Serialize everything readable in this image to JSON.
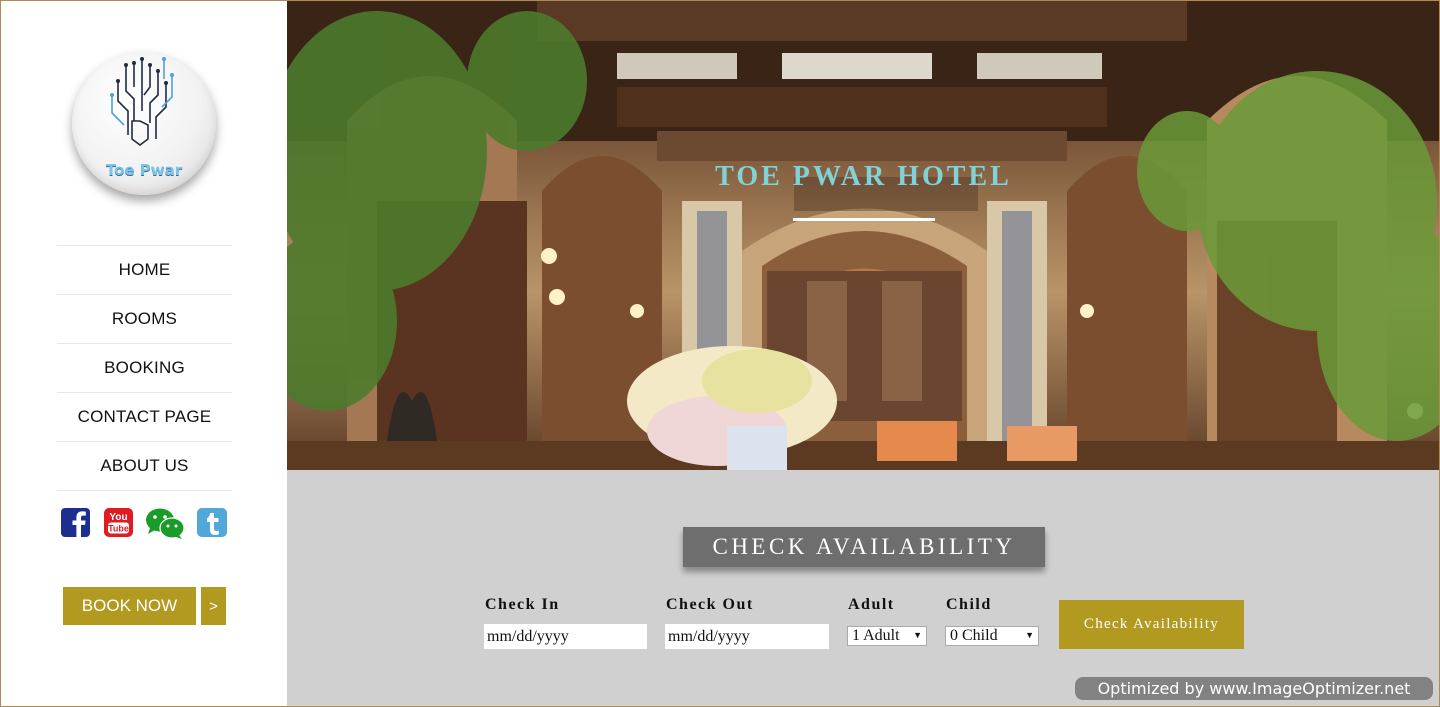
{
  "sidebar": {
    "logo_text": "Toe Pwar",
    "nav": [
      "HOME",
      "ROOMS",
      "BOOKING",
      "CONTACT PAGE",
      "ABOUT US"
    ],
    "social_icons": [
      "facebook-icon",
      "youtube-icon",
      "wechat-icon",
      "tumblr-icon"
    ],
    "book_now_label": "BOOK NOW",
    "book_arrow_label": ">"
  },
  "hero": {
    "title": "TOE PWAR HOTEL"
  },
  "availability": {
    "heading": "CHECK AVAILABILITY",
    "check_in_label": "Check In",
    "check_in_placeholder": "mm/dd/yyyy",
    "check_out_label": "Check Out",
    "check_out_placeholder": "mm/dd/yyyy",
    "adult_label": "Adult",
    "adult_value": "1 Adult",
    "child_label": "Child",
    "child_value": "0 Child",
    "button_label": "Check Availability"
  },
  "watermark": "Optimized by www.ImageOptimizer.net",
  "colors": {
    "accent_gold": "#b29a21",
    "hero_title": "#7fd3d8",
    "panel_gray": "#d0d0d0",
    "heading_gray": "#6e6e6e"
  }
}
